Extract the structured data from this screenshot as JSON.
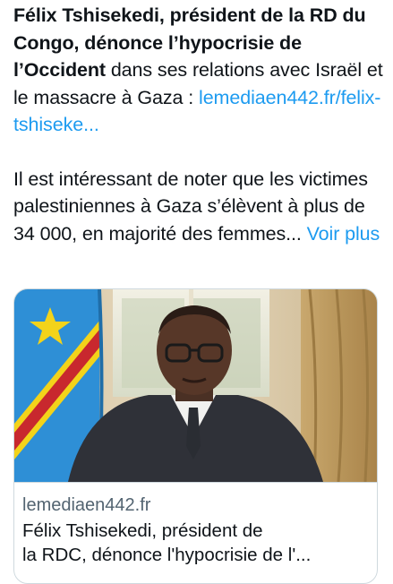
{
  "post": {
    "text_bold": "Félix Tshisekedi, président de la RD du Congo, dénonce l’hypocrisie de l’Occident",
    "text_rest": " dans ses relations avec Israël et le massacre à Gaza : ",
    "link": "lemediaen442.fr/felix-tshiseke...",
    "paragraph2": "Il est intéressant de noter que les victimes palestiniennes à Gaza s’élèvent à plus de 34 000, en majorité des femmes... ",
    "show_more": "Voir plus"
  },
  "card": {
    "domain": "lemediaen442.fr",
    "title_line1": "Félix Tshisekedi, président de",
    "title_line2": "la RDC, dénonce l'hypocrisie de l'..."
  },
  "colors": {
    "link": "#1d9bf0",
    "secondary_text": "#536471",
    "border": "#cfd9de"
  }
}
